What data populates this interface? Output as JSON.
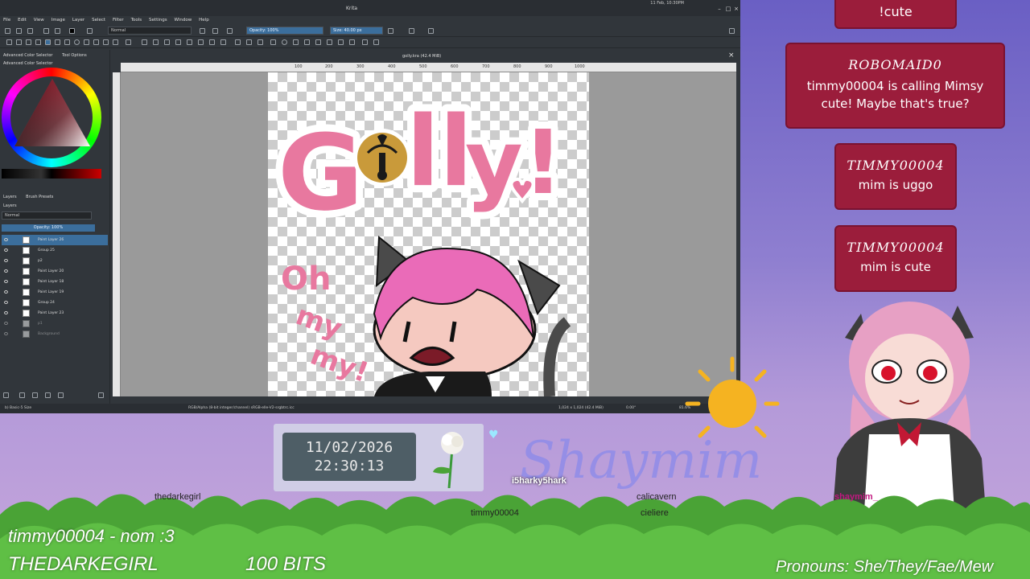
{
  "krita": {
    "window_title": "Krita",
    "system_clock": "11 Feb, 10:30PM",
    "menu": [
      "File",
      "Edit",
      "View",
      "Image",
      "Layer",
      "Select",
      "Filter",
      "Tools",
      "Settings",
      "Window",
      "Help"
    ],
    "blend_mode": "Normal",
    "opacity_field": "Opacity: 100%",
    "size_field": "Size: 40.00 px",
    "docker_tabs": [
      "Advanced Color Selector",
      "Tool Options"
    ],
    "docker_subtitle": "Advanced Color Selector",
    "layers_tabs": [
      "Layers",
      "Brush Presets"
    ],
    "layers_title": "Layers",
    "layers_blend": "Normal",
    "layers_opacity": "Opacity: 100%",
    "layers": [
      {
        "name": "Paint Layer 26",
        "selected": true
      },
      {
        "name": "Group 25",
        "selected": false
      },
      {
        "name": "p2",
        "selected": false
      },
      {
        "name": "Paint Layer 20",
        "selected": false
      },
      {
        "name": "Paint Layer 18",
        "selected": false
      },
      {
        "name": "Paint Layer 19",
        "selected": false
      },
      {
        "name": "Group 24",
        "selected": false
      },
      {
        "name": "Paint Layer 23",
        "selected": false
      },
      {
        "name": "p1",
        "selected": false
      },
      {
        "name": "Background",
        "selected": false
      }
    ],
    "document_tab": "golly.kra (42.4 MiB)",
    "ruler_ticks": [
      "100",
      "200",
      "300",
      "400",
      "500",
      "600",
      "700",
      "800",
      "900",
      "1000"
    ],
    "status_brush": "b) Basic-5 Size",
    "status_color": "RGB/Alpha (8-bit integer/channel)  sRGB-elle-V2-srgbtrc.icc",
    "status_dims": "1,024 x 1,024 (42.4 MiB)",
    "status_angle": "0.00°",
    "status_zoom": "81.6%"
  },
  "artwork": {
    "word_golly": "Golly!",
    "word_oh": "Oh",
    "word_my1": "my",
    "word_my2": "my!"
  },
  "chat": [
    {
      "user": "",
      "message": "!cute"
    },
    {
      "user": "ROBOMAID0",
      "message": "timmy00004 is calling Mimsy cute! Maybe that's true?"
    },
    {
      "user": "TIMMY00004",
      "message": "mim is uggo"
    },
    {
      "user": "TIMMY00004",
      "message": "mim is cute"
    }
  ],
  "clock": {
    "date": "11/02/2026",
    "time": "22:30:13"
  },
  "overlay": {
    "alert_line": "timmy00004 - nom :3",
    "alert_user": "THEDARKEGIRL",
    "alert_amount": "100 BITS",
    "pronouns": "Pronouns: She/They/Fae/Mew",
    "signature": "Shaymim"
  },
  "chatters": {
    "thedarkegirl": "thedarkegirl",
    "i5harky5hark": "i5harky5hark",
    "timmy00004": "timmy00004",
    "calicavern": "calicavern",
    "cieliere": "cieliere",
    "shaymim": "shaymim_"
  },
  "colors": {
    "chat_card": "#9b1d3b",
    "krita_panel": "#31363b",
    "accent_blue": "#3b6e9c",
    "grass": "#4aa336",
    "pink_text": "#e8789f"
  }
}
